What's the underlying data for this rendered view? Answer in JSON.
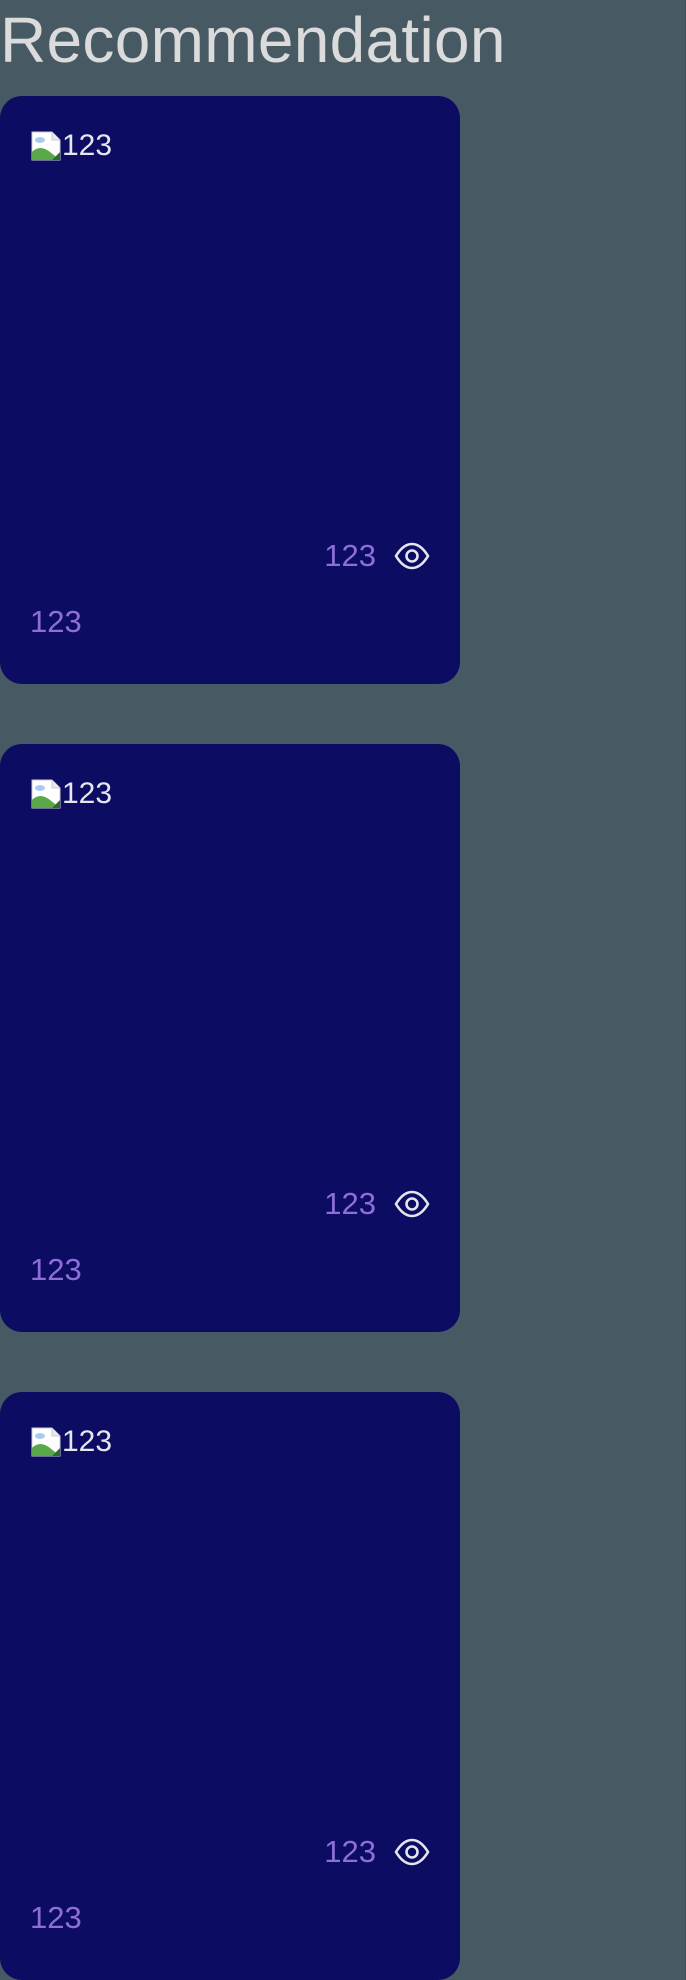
{
  "page": {
    "title": "Recommendation"
  },
  "cards": [
    {
      "image_alt": "123",
      "view_count": "123",
      "footer": "123"
    },
    {
      "image_alt": "123",
      "view_count": "123",
      "footer": "123"
    },
    {
      "image_alt": "123",
      "view_count": "123",
      "footer": "123"
    }
  ],
  "colors": {
    "background": "#475a64",
    "card": "#0d0c63",
    "title": "#dbdbdb",
    "accent_text": "#8e6fd8",
    "icon": "#e6e6ee"
  },
  "icons": {
    "image_placeholder": "broken-image-icon",
    "views": "eye-icon"
  }
}
